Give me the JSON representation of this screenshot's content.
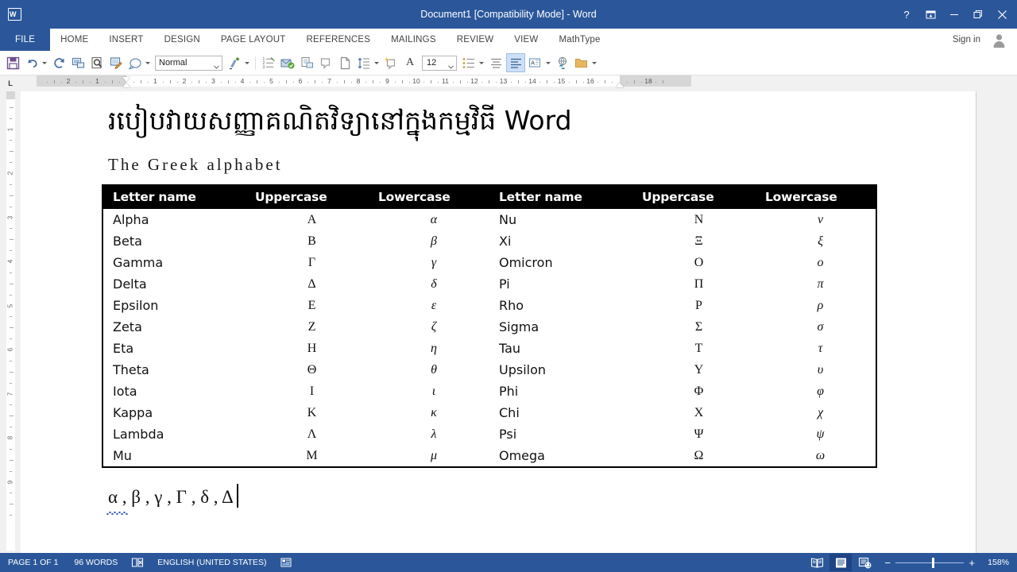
{
  "window": {
    "title": "Document1 [Compatibility Mode] - Word",
    "help_icon": "?",
    "ribbon_display_icon": "ribbon-display-options-icon",
    "minimize_icon": "minimize-icon",
    "restore_icon": "restore-icon",
    "close_icon": "close-icon",
    "app_icon": "word-logo-icon"
  },
  "ribbon": {
    "tabs": [
      {
        "label": "FILE",
        "active": true
      },
      {
        "label": "HOME",
        "active": false
      },
      {
        "label": "INSERT",
        "active": false
      },
      {
        "label": "DESIGN",
        "active": false
      },
      {
        "label": "PAGE LAYOUT",
        "active": false
      },
      {
        "label": "REFERENCES",
        "active": false
      },
      {
        "label": "MAILINGS",
        "active": false
      },
      {
        "label": "REVIEW",
        "active": false
      },
      {
        "label": "VIEW",
        "active": false
      },
      {
        "label": "MathType",
        "active": false
      }
    ],
    "sign_in": "Sign in",
    "account_icon": "account-avatar-icon"
  },
  "toolbar": {
    "style_value": "Normal",
    "font_size_value": "12",
    "buttons": [
      "save-icon",
      "undo-icon",
      "redo-icon",
      "print-layout-icon",
      "print-preview-icon",
      "track-changes-icon",
      "shapes-icon"
    ]
  },
  "ruler": {
    "tab_selector": "L",
    "horizontal_labels": [
      "2",
      "1",
      "1",
      "2",
      "3",
      "4",
      "5",
      "6",
      "7",
      "8",
      "9",
      "10",
      "11",
      "12",
      "13",
      "14",
      "15",
      "16",
      "18"
    ],
    "vertical_labels": [
      "1",
      "2",
      "3",
      "4",
      "5",
      "6",
      "7",
      "8",
      "9"
    ]
  },
  "document": {
    "title": "របៀបវាយសញ្ញាគណិតវិទ្យានៅក្នុងកម្មវិធី Word",
    "subtitle": "The Greek alphabet",
    "typed_line": "α , β , γ , Γ , δ , Δ"
  },
  "chart_data": {
    "type": "table",
    "title": "The Greek alphabet",
    "headers": [
      "Letter name",
      "Uppercase",
      "Lowercase",
      "Letter name",
      "Uppercase",
      "Lowercase"
    ],
    "rows": [
      [
        "Alpha",
        "Α",
        "α",
        "Nu",
        "Ν",
        "ν"
      ],
      [
        "Beta",
        "Β",
        "β",
        "Xi",
        "Ξ",
        "ξ"
      ],
      [
        "Gamma",
        "Γ",
        "γ",
        "Omicron",
        "Ο",
        "ο"
      ],
      [
        "Delta",
        "Δ",
        "δ",
        "Pi",
        "Π",
        "π"
      ],
      [
        "Epsilon",
        "Ε",
        "ε",
        "Rho",
        "Ρ",
        "ρ"
      ],
      [
        "Zeta",
        "Ζ",
        "ζ",
        "Sigma",
        "Σ",
        "σ"
      ],
      [
        "Eta",
        "Η",
        "η",
        "Tau",
        "Τ",
        "τ"
      ],
      [
        "Theta",
        "Θ",
        "θ",
        "Upsilon",
        "Υ",
        "υ"
      ],
      [
        "Iota",
        "Ι",
        "ι",
        "Phi",
        "Φ",
        "φ"
      ],
      [
        "Kappa",
        "Κ",
        "κ",
        "Chi",
        "Χ",
        "χ"
      ],
      [
        "Lambda",
        "Λ",
        "λ",
        "Psi",
        "Ψ",
        "ψ"
      ],
      [
        "Mu",
        "Μ",
        "μ",
        "Omega",
        "Ω",
        "ω"
      ]
    ],
    "header_bg": "#000000",
    "header_fg": "#ffffff",
    "border_color": "#000000"
  },
  "statusbar": {
    "page": "PAGE 1 OF 1",
    "words": "96 WORDS",
    "proofing_icon": "proofing-errors-icon",
    "language": "ENGLISH (UNITED STATES)",
    "macro_icon": "macro-record-icon",
    "view_read": "read-mode-icon",
    "view_print": "print-layout-icon",
    "view_web": "web-layout-icon",
    "zoom_out": "−",
    "zoom_in": "+",
    "zoom_level": "158%"
  },
  "colors": {
    "accent": "#2b579a",
    "titlebar": "#2b579a",
    "statusbar": "#2b579a",
    "canvas_bg": "#f1f1f1",
    "page_bg": "#ffffff"
  }
}
